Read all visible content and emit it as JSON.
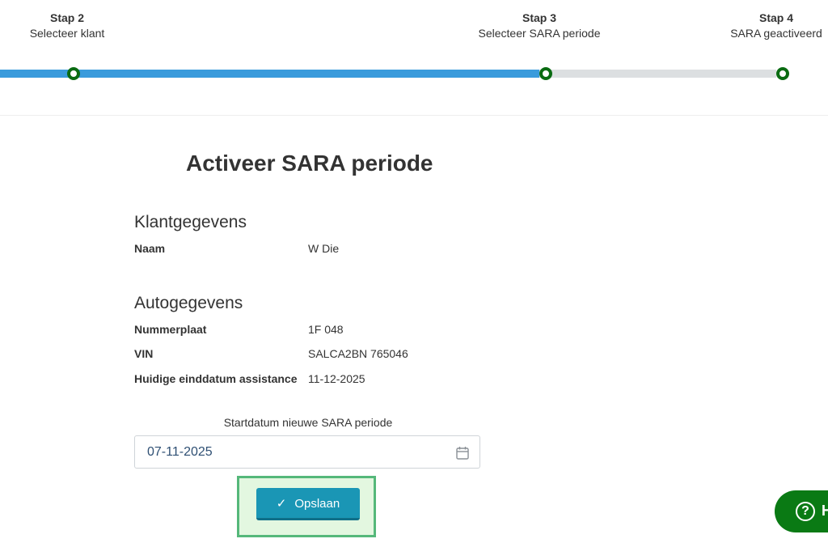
{
  "stepper": {
    "steps": [
      {
        "title": "Stap 2",
        "subtitle": "Selecteer klant"
      },
      {
        "title": "Stap 3",
        "subtitle": "Selecteer SARA periode"
      },
      {
        "title": "Stap 4",
        "subtitle": "SARA geactiveerd"
      }
    ],
    "colors": {
      "completed_track": "#3a9bdc",
      "pending_track": "#dcdfe1",
      "node_border": "#0a6b12"
    }
  },
  "page": {
    "title": "Activeer SARA periode"
  },
  "customer": {
    "section_title": "Klantgegevens",
    "name_label": "Naam",
    "name_value": "W    Die"
  },
  "car": {
    "section_title": "Autogegevens",
    "plate_label": "Nummerplaat",
    "plate_value": "1F    048",
    "vin_label": "VIN",
    "vin_value": "SALCA2BN   765046",
    "end_label": "Huidige einddatum assistance",
    "end_value": "11-12-2025"
  },
  "form": {
    "start_label": "Startdatum nieuwe SARA periode",
    "start_value": "07-11-2025",
    "calendar_icon": "calendar-icon"
  },
  "actions": {
    "save_label": "Opslaan",
    "save_icon": "check-icon",
    "save_color": "#1a96b5"
  },
  "help": {
    "label": "H",
    "icon": "help-icon",
    "color": "#0a7a14"
  }
}
